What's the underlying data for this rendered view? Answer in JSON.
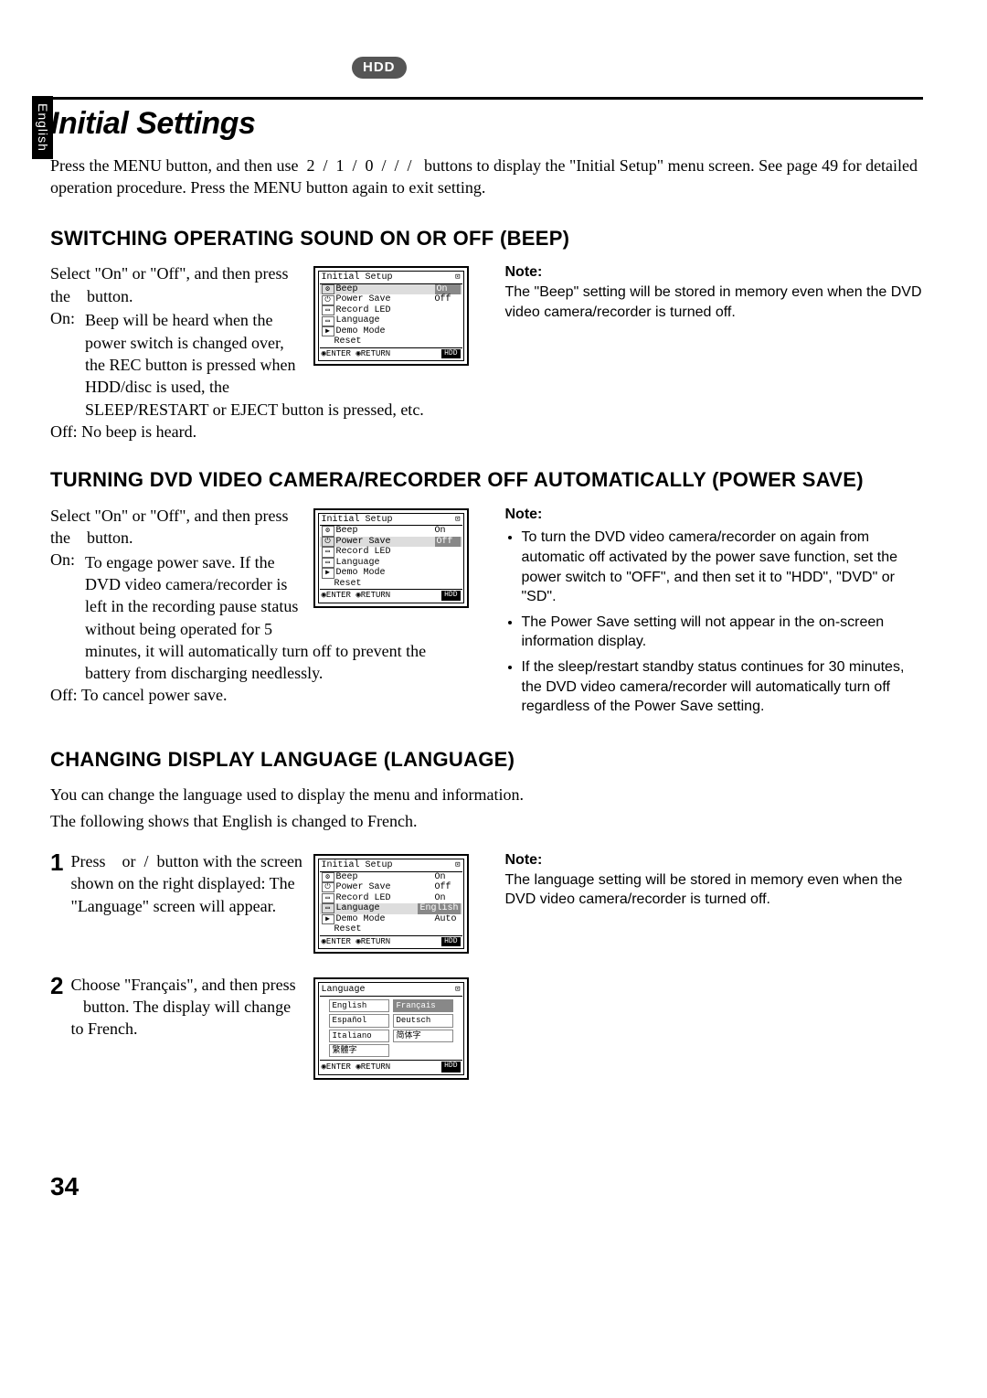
{
  "tag": "HDD",
  "language_tab": "English",
  "page_title": "Initial Settings",
  "intro": "Press the MENU button, and then use  2  /  1  /  0  /  /  /   buttons to display the \"Initial Setup\" menu screen. See page 49 for detailed operation procedure. Press the MENU button again to exit setting.",
  "section1": {
    "heading": "SWITCHING OPERATING SOUND ON OR OFF (BEEP)",
    "body1": "Select \"On\" or \"Off\", and then press the    button.",
    "on_label": "On:",
    "on_text": "Beep will be heard when the power switch is changed over, the REC button is pressed when HDD/disc is used, the SLEEP/RESTART or EJECT button is pressed, etc.",
    "off_label": "Off:",
    "off_text": "No beep is heard.",
    "note_label": "Note:",
    "note_text": "The \"Beep\" setting will be stored in memory even when the DVD video camera/recorder is turned off."
  },
  "section2": {
    "heading": "TURNING DVD VIDEO CAMERA/RECORDER OFF AUTOMATICALLY (POWER SAVE)",
    "body1": "Select \"On\" or \"Off\", and then press the    button.",
    "on_label": "On:",
    "on_text": "To engage power save. If the DVD video camera/recorder is left in the recording pause status without being operated for 5 minutes, it will automatically turn off to prevent the battery from discharging needlessly.",
    "off_label": "Off:",
    "off_text": "To cancel power save.",
    "note_label": "Note:",
    "bullets": [
      "To turn the DVD video camera/recorder on again from automatic off activated by the power save function, set the power switch to \"OFF\", and then set it to \"HDD\", \"DVD\" or \"SD\".",
      "The Power Save setting will not appear in the on-screen information display.",
      "If the sleep/restart standby status continues for 30 minutes, the DVD video camera/recorder will automatically turn off regardless of the Power Save setting."
    ]
  },
  "section3": {
    "heading": "CHANGING DISPLAY LANGUAGE (LANGUAGE)",
    "intro1": "You can change the language used to display the menu and information.",
    "intro2": "The following shows that English is changed to French.",
    "step1_num": "1",
    "step1_text": "Press    or  /  button with the screen shown on the right displayed: The \"Language\" screen will appear.",
    "step2_num": "2",
    "step2_text": "Choose \"Français\", and then press    button. The display will change to French.",
    "note_label": "Note:",
    "note_text": "The language setting will be stored in memory even when the DVD video camera/recorder is turned off."
  },
  "menu_common": {
    "title": "Initial Setup",
    "footer_enter": "ENTER",
    "footer_return": "RETURN",
    "footer_hdd": "HDD",
    "items": [
      "Beep",
      "Power Save",
      "Record LED",
      "Language",
      "Demo Mode",
      "Reset"
    ]
  },
  "menu1_values": {
    "beep": "On",
    "power_save": "Off"
  },
  "menu2_values": {
    "beep": "On",
    "power_save": "Off"
  },
  "menu3_values": {
    "beep": "On",
    "power_save": "Off",
    "record_led": "On",
    "language": "English",
    "demo_mode": "Auto"
  },
  "lang_menu": {
    "title": "Language",
    "options": [
      "English",
      "Français",
      "Español",
      "Deutsch",
      "Italiano",
      "简体字",
      "繁體字"
    ]
  },
  "page_number": "34"
}
